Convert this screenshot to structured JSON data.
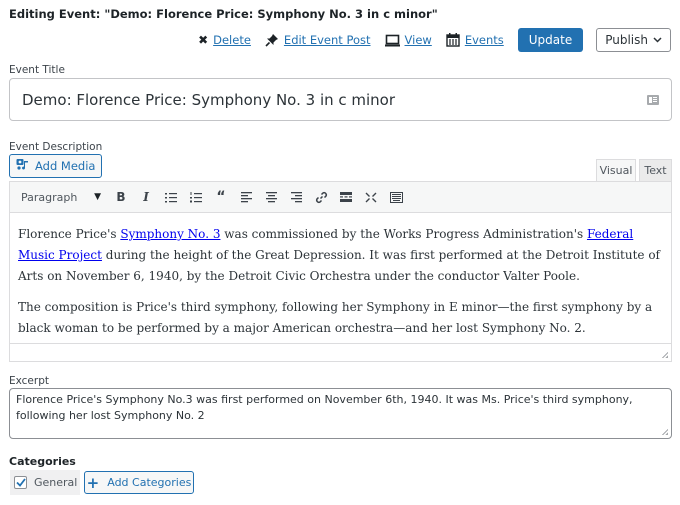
{
  "header": {
    "heading": "Editing Event: \"Demo: Florence Price: Symphony No. 3 in c minor\"",
    "actions": [
      {
        "label": "Delete",
        "icon": "close-icon",
        "glyph": "✖"
      },
      {
        "label": "Edit Event Post",
        "icon": "pin-icon",
        "glyph": "📌"
      },
      {
        "label": "View",
        "icon": "laptop-icon",
        "glyph": "▭"
      },
      {
        "label": "Events",
        "icon": "calendar-icon",
        "glyph": "▦"
      }
    ],
    "update_label": "Update",
    "publish_label": "Publish",
    "publish_chevron": "⌄"
  },
  "title_field": {
    "label": "Event Title",
    "value": "Demo: Florence Price: Symphony No. 3 in c minor"
  },
  "description": {
    "label": "Event Description",
    "add_media_label": "Add Media",
    "tabs": [
      "Visual",
      "Text"
    ],
    "active_tab": "Visual",
    "format_select": "Paragraph",
    "toolbar": [
      {
        "name": "bold-button",
        "glyph": "B"
      },
      {
        "name": "italic-button",
        "glyph": "I"
      },
      {
        "name": "bullet-list-button",
        "glyph": "☰"
      },
      {
        "name": "numbered-list-button",
        "glyph": "☷"
      },
      {
        "name": "blockquote-button",
        "glyph": "❝"
      },
      {
        "name": "align-left-button",
        "glyph": "≡"
      },
      {
        "name": "align-center-button",
        "glyph": "≡"
      },
      {
        "name": "align-right-button",
        "glyph": "≡"
      },
      {
        "name": "link-button",
        "glyph": "🔗"
      },
      {
        "name": "read-more-button",
        "glyph": "▬"
      },
      {
        "name": "fullscreen-button",
        "glyph": "⤧"
      },
      {
        "name": "toolbar-toggle-button",
        "glyph": "▦"
      }
    ],
    "p1": {
      "t1": "Florence Price's ",
      "link1": "Symphony No. 3",
      "t2": " was commissioned by the Works Progress Administration's ",
      "link2": "Federal Music Project",
      "t3": " during the height of the Great Depression. It was first performed at the Detroit Institute of Arts on November 6, 1940, by the Detroit Civic Orchestra under the conductor Valter Poole."
    },
    "p2": "The composition is Price's third symphony, following her Symphony in E minor—the first symphony by a black woman to be performed by a major American orchestra—and her lost Symphony No. 2."
  },
  "excerpt": {
    "label": "Excerpt",
    "value": "Florence Price's Symphony No.3 was first performed on November 6th, 1940. It was Ms. Price's third symphony, following her lost Symphony No. 2"
  },
  "categories": {
    "label": "Categories",
    "items": [
      {
        "label": "General",
        "checked": true
      }
    ],
    "add_label": "Add Categories"
  },
  "colors": {
    "accent": "#2271b1",
    "link": "#0000ee"
  }
}
